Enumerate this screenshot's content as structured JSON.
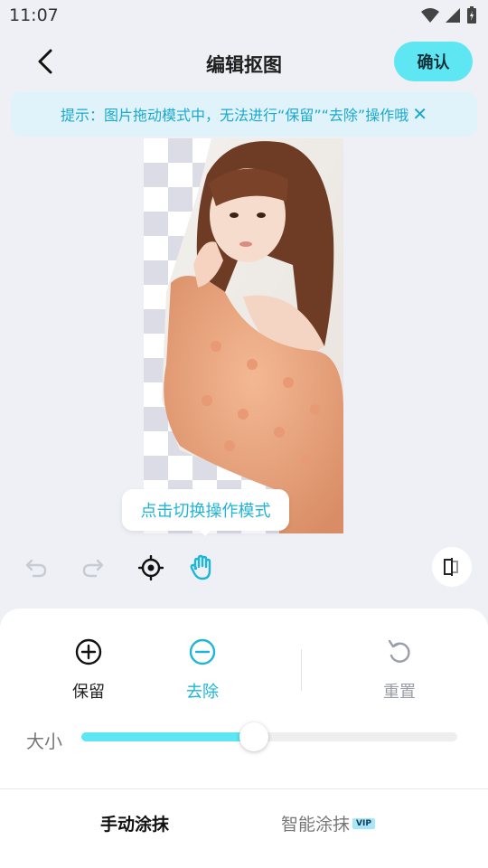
{
  "status": {
    "time": "11:07"
  },
  "header": {
    "title": "编辑抠图",
    "confirm_label": "确认"
  },
  "hint": {
    "text": "提示：图片拖动模式中，无法进行“保留”“去除”操作哦",
    "close_icon": "close-icon"
  },
  "tooltip": {
    "text": "点击切换操作模式"
  },
  "toolbar": {
    "icons": [
      "undo-icon",
      "redo-icon",
      "locate-icon",
      "hand-drag-icon",
      "compare-icon"
    ],
    "active_tool": "hand-drag-icon"
  },
  "modes": {
    "keep_label": "保留",
    "remove_label": "去除",
    "reset_label": "重置",
    "active": "去除"
  },
  "brush_size": {
    "label": "大小",
    "value_fraction": 0.46
  },
  "tabs": {
    "manual_label": "手动涂抹",
    "smart_label": "智能涂抹",
    "vip_badge": "VIP",
    "active": "手动涂抹"
  },
  "colors": {
    "accent": "#5ee6f2",
    "accent_text": "#1aa8cf",
    "background": "#eef0f5",
    "hint_bg": "#e0f3fb"
  }
}
